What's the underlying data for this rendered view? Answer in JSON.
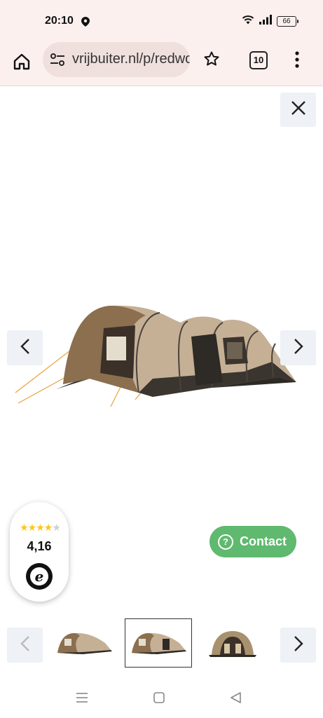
{
  "status_bar": {
    "time": "20:10",
    "battery": "66",
    "icons": [
      "location-icon",
      "wifi-icon",
      "signal-icon",
      "battery-icon"
    ]
  },
  "browser": {
    "url": "vrijbuiter.nl/p/redwood",
    "tab_count": "10",
    "icons": [
      "home-icon",
      "site-settings-icon",
      "bookmark-star-icon",
      "tabs-icon",
      "menu-icon"
    ]
  },
  "gallery": {
    "close_icon": "close-icon",
    "prev_icon": "chevron-left-icon",
    "next_icon": "chevron-right-icon",
    "main_image": "tent-image"
  },
  "rating": {
    "stars_filled": 4,
    "stars_total": 5,
    "value": "4,16",
    "logo": "e"
  },
  "contact": {
    "label": "Contact",
    "icon": "?"
  },
  "thumbnails": {
    "items": [
      "tent-thumbnail-1",
      "tent-thumbnail-2",
      "tent-thumbnail-3"
    ],
    "selected_index": 1
  },
  "system_nav": [
    "recents-icon",
    "home-square-icon",
    "back-triangle-icon"
  ],
  "colors": {
    "chrome_bg": "#fcf0ee",
    "button_bg": "#eef1f5",
    "contact_green": "#5fb96f",
    "star_gold": "#ffc61a"
  }
}
